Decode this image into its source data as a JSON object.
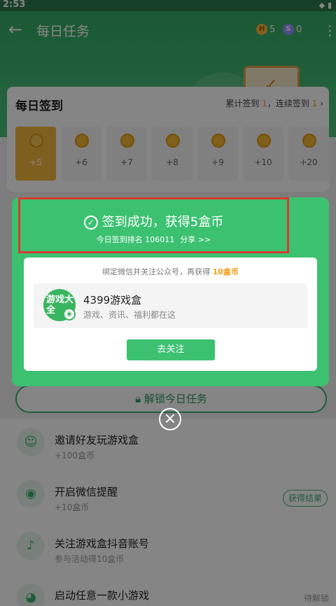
{
  "status_bar": {
    "time": "2:53"
  },
  "app_bar": {
    "title": "每日任务",
    "coin_h_label": "H",
    "coin_h_value": "5",
    "coin_s_label": "S",
    "coin_s_value": "0"
  },
  "signin": {
    "title": "每日签到",
    "stats_prefix": "累计签到 ",
    "total_days": "1",
    "stats_mid": "，连续签到 ",
    "streak_days": "1",
    "days": [
      "+5",
      "+6",
      "+7",
      "+8",
      "+9",
      "+10",
      "+20"
    ]
  },
  "dialog": {
    "success_text": "签到成功，获得5盒币",
    "rank_text": "今日签到排名 106011",
    "share_text": "分享 >>",
    "bind_prefix": "绑定微信并关注公众号，再获得 ",
    "bind_bonus": "10盒币",
    "account_name": "4399游戏盒",
    "account_desc": "游戏、资讯、福利都在这",
    "avatar_text": "游戏大全",
    "follow_button": "去关注"
  },
  "unlock_button": "解锁今日任务",
  "tasks": [
    {
      "title": "邀请好友玩游戏盒",
      "sub": "+100盒币"
    },
    {
      "title": "开启微信提醒",
      "sub": "+10盒币",
      "action": "获得结果"
    },
    {
      "title": "关注游戏盒抖音账号",
      "sub": "参与活动得10盒币"
    },
    {
      "title": "启动任意一款小游戏",
      "action": "待解锁"
    }
  ]
}
